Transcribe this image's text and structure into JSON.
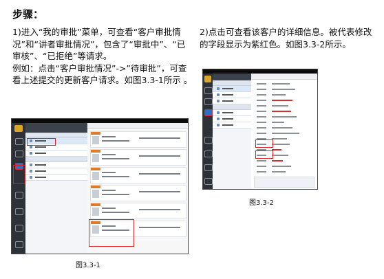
{
  "heading": "步骤：",
  "left_col": {
    "para1": "1)进入“我的审批”菜单，可查看“客户审批情况”和“讲者审批情况”，包含了“审批中”、“已审核”、“已拒绝”等请求。",
    "para2": "例如：点击“客户审批情况”->”待审批”，可查看上述提交的更新客户请求。如图3.3-1所示 。"
  },
  "right_col": {
    "para1": "2)点击可查看该客户的详细信息。被代表修改的字段显示为紫红色。如图3.3-2所示。"
  },
  "captions": {
    "fig1": "图3.3-1",
    "fig2": "图3.3-2"
  },
  "colors": {
    "highlight_box": "#e02020",
    "accent_blue": "#2a73c4",
    "rail_dark": "#2e3238"
  },
  "icons": {
    "app_logo": "app-logo-icon",
    "rail_items": [
      "home-icon",
      "approval-icon",
      "my-approval-icon",
      "list-icon",
      "sync-icon",
      "settings-icon",
      "power-icon"
    ]
  }
}
